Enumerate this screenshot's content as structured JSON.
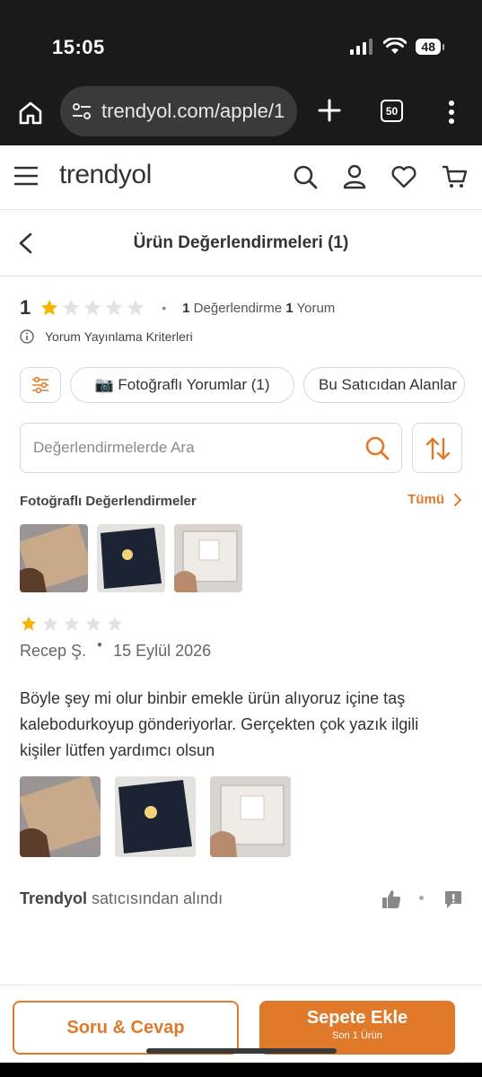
{
  "status_bar": {
    "time": "15:05",
    "battery": "48"
  },
  "browser": {
    "url": "trendyol.com/apple/1",
    "tab_count": "50"
  },
  "header": {
    "logo": "trendyol"
  },
  "reviews_page": {
    "title": "Ürün Değerlendirmeleri (1)",
    "summary": {
      "rating": "1",
      "rating_count": "1",
      "rating_count_label": "Değerlendirme",
      "comment_count": "1",
      "comment_count_label": "Yorum"
    },
    "criteria_label": "Yorum Yayınlama Kriterleri",
    "filters": {
      "photo_reviews": "📷 Fotoğraflı Yorumlar (1)",
      "from_seller": "Bu Satıcıdan Alanlar"
    },
    "search": {
      "placeholder": "Değerlendirmelerde Ara"
    },
    "photo_reviews_section": {
      "title": "Fotoğraflı Değerlendirmeler",
      "see_all": "Tümü"
    }
  },
  "review": {
    "stars": 1,
    "author": "Recep Ş.",
    "date": "15 Eylül 2026",
    "text": "Böyle şey mi olur binbir emekle ürün alıyoruz içine taş kalebodurkoyup gönderiyorlar. Gerçekten çok yazık ilgili kişiler lütfen yardımcı olsun",
    "seller_name": "Trendyol",
    "seller_suffix": "satıcısından alındı"
  },
  "bottom_bar": {
    "qa_label": "Soru & Cevap",
    "cart_label": "Sepete Ekle",
    "cart_sub": "Son 1 Ürün"
  },
  "colors": {
    "accent": "#e07a2a",
    "star_filled": "#f5b400",
    "star_empty": "#e3e3e3"
  }
}
